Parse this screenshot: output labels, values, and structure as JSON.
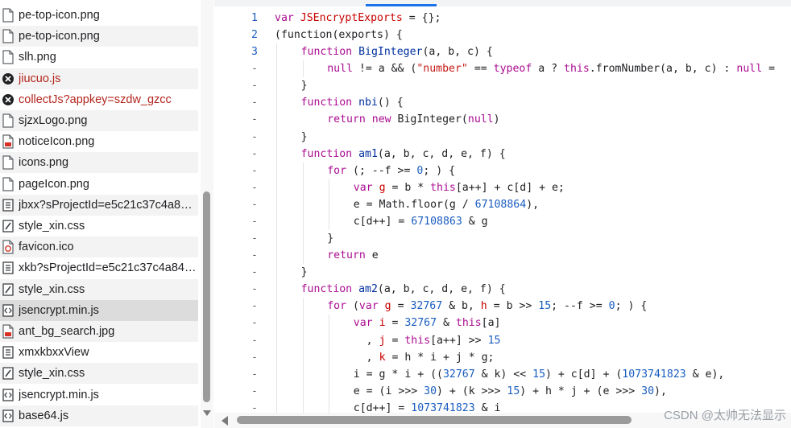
{
  "files": [
    {
      "name": "pe-top-icon.png",
      "icon": "file-icon",
      "error": false
    },
    {
      "name": "pe-top-icon.png",
      "icon": "file-icon",
      "error": false
    },
    {
      "name": "slh.png",
      "icon": "file-icon",
      "error": false
    },
    {
      "name": "jiucuo.js",
      "icon": "error-icon",
      "error": true
    },
    {
      "name": "collectJs?appkey=szdw_gzcc",
      "icon": "error-icon",
      "error": true
    },
    {
      "name": "sjzxLogo.png",
      "icon": "file-icon",
      "error": false
    },
    {
      "name": "noticeIcon.png",
      "icon": "image-file-icon",
      "error": false
    },
    {
      "name": "icons.png",
      "icon": "file-icon",
      "error": false
    },
    {
      "name": "pageIcon.png",
      "icon": "file-icon",
      "error": false
    },
    {
      "name": "jbxx?sProjectId=e5c21c37c4a8…",
      "icon": "document-icon",
      "error": false
    },
    {
      "name": "style_xin.css",
      "icon": "stylesheet-icon",
      "error": false
    },
    {
      "name": "favicon.ico",
      "icon": "favicon-file-icon",
      "error": false
    },
    {
      "name": "xkb?sProjectId=e5c21c37c4a84…",
      "icon": "document-icon",
      "error": false
    },
    {
      "name": "style_xin.css",
      "icon": "stylesheet-icon",
      "error": false
    },
    {
      "name": "jsencrypt.min.js",
      "icon": "script-icon",
      "error": false,
      "selected": true
    },
    {
      "name": "ant_bg_search.jpg",
      "icon": "image-file-icon",
      "error": false
    },
    {
      "name": "xmxkbxxView",
      "icon": "document-icon",
      "error": false
    },
    {
      "name": "style_xin.css",
      "icon": "stylesheet-icon",
      "error": false
    },
    {
      "name": "jsencrypt.min.js",
      "icon": "script-icon",
      "error": false
    },
    {
      "name": "base64.js",
      "icon": "script-icon",
      "error": false
    }
  ],
  "code_lines": [
    {
      "gutter": "1",
      "indent": 0,
      "tokens": [
        [
          "kw",
          "var "
        ],
        [
          "var",
          "JSEncryptExports"
        ],
        [
          "p",
          " = {};"
        ]
      ]
    },
    {
      "gutter": "2",
      "indent": 0,
      "tokens": [
        [
          "p",
          "(function(exports) {"
        ]
      ]
    },
    {
      "gutter": "3",
      "indent": 1,
      "tokens": [
        [
          "kw",
          "function "
        ],
        [
          "fn",
          "BigInteger"
        ],
        [
          "p",
          "(a, b, c) {"
        ]
      ]
    },
    {
      "gutter": "-",
      "indent": 2,
      "tokens": [
        [
          "kw",
          "null"
        ],
        [
          "p",
          " != a && ("
        ],
        [
          "str",
          "\"number\""
        ],
        [
          "p",
          " == "
        ],
        [
          "kw",
          "typeof"
        ],
        [
          "p",
          " a ? "
        ],
        [
          "kw",
          "this"
        ],
        [
          "p",
          ".fromNumber(a, b, c) : "
        ],
        [
          "kw",
          "null"
        ],
        [
          "p",
          " ="
        ]
      ]
    },
    {
      "gutter": "-",
      "indent": 1,
      "tokens": [
        [
          "p",
          "}"
        ]
      ]
    },
    {
      "gutter": "-",
      "indent": 1,
      "tokens": [
        [
          "kw",
          "function "
        ],
        [
          "fn",
          "nbi"
        ],
        [
          "p",
          "() {"
        ]
      ]
    },
    {
      "gutter": "-",
      "indent": 2,
      "tokens": [
        [
          "kw",
          "return new "
        ],
        [
          "p",
          "BigInteger("
        ],
        [
          "kw",
          "null"
        ],
        [
          "p",
          ")"
        ]
      ]
    },
    {
      "gutter": "-",
      "indent": 1,
      "tokens": [
        [
          "p",
          "}"
        ]
      ]
    },
    {
      "gutter": "-",
      "indent": 1,
      "tokens": [
        [
          "kw",
          "function "
        ],
        [
          "fn",
          "am1"
        ],
        [
          "p",
          "(a, b, c, d, e, f) {"
        ]
      ]
    },
    {
      "gutter": "-",
      "indent": 2,
      "tokens": [
        [
          "kw",
          "for"
        ],
        [
          "p",
          " (; --f >= "
        ],
        [
          "num",
          "0"
        ],
        [
          "p",
          "; ) {"
        ]
      ]
    },
    {
      "gutter": "-",
      "indent": 3,
      "tokens": [
        [
          "kw",
          "var "
        ],
        [
          "var",
          "g"
        ],
        [
          "p",
          " = b * "
        ],
        [
          "kw",
          "this"
        ],
        [
          "p",
          "[a++] + c[d] + e;"
        ]
      ]
    },
    {
      "gutter": "-",
      "indent": 3,
      "tokens": [
        [
          "p",
          "e = Math.floor(g / "
        ],
        [
          "num",
          "67108864"
        ],
        [
          "p",
          "),"
        ]
      ]
    },
    {
      "gutter": "-",
      "indent": 3,
      "tokens": [
        [
          "p",
          "c[d++] = "
        ],
        [
          "num",
          "67108863"
        ],
        [
          "p",
          " & g"
        ]
      ]
    },
    {
      "gutter": "-",
      "indent": 2,
      "tokens": [
        [
          "p",
          "}"
        ]
      ]
    },
    {
      "gutter": "-",
      "indent": 2,
      "tokens": [
        [
          "kw",
          "return"
        ],
        [
          "p",
          " e"
        ]
      ]
    },
    {
      "gutter": "-",
      "indent": 1,
      "tokens": [
        [
          "p",
          "}"
        ]
      ]
    },
    {
      "gutter": "-",
      "indent": 1,
      "tokens": [
        [
          "kw",
          "function "
        ],
        [
          "fn",
          "am2"
        ],
        [
          "p",
          "(a, b, c, d, e, f) {"
        ]
      ]
    },
    {
      "gutter": "-",
      "indent": 2,
      "tokens": [
        [
          "kw",
          "for"
        ],
        [
          "p",
          " ("
        ],
        [
          "kw",
          "var "
        ],
        [
          "var",
          "g"
        ],
        [
          "p",
          " = "
        ],
        [
          "num",
          "32767"
        ],
        [
          "p",
          " & b, "
        ],
        [
          "var",
          "h"
        ],
        [
          "p",
          " = b >> "
        ],
        [
          "num",
          "15"
        ],
        [
          "p",
          "; --f >= "
        ],
        [
          "num",
          "0"
        ],
        [
          "p",
          "; ) {"
        ]
      ]
    },
    {
      "gutter": "-",
      "indent": 3,
      "tokens": [
        [
          "kw",
          "var "
        ],
        [
          "var",
          "i"
        ],
        [
          "p",
          " = "
        ],
        [
          "num",
          "32767"
        ],
        [
          "p",
          " & "
        ],
        [
          "kw",
          "this"
        ],
        [
          "p",
          "[a]"
        ]
      ]
    },
    {
      "gutter": "-",
      "indent": 3,
      "tokens": [
        [
          "p",
          "  , "
        ],
        [
          "var",
          "j"
        ],
        [
          "p",
          " = "
        ],
        [
          "kw",
          "this"
        ],
        [
          "p",
          "[a++] >> "
        ],
        [
          "num",
          "15"
        ]
      ]
    },
    {
      "gutter": "-",
      "indent": 3,
      "tokens": [
        [
          "p",
          "  , "
        ],
        [
          "var",
          "k"
        ],
        [
          "p",
          " = h * i + j * g;"
        ]
      ]
    },
    {
      "gutter": "-",
      "indent": 3,
      "tokens": [
        [
          "p",
          "i = g * i + (("
        ],
        [
          "num",
          "32767"
        ],
        [
          "p",
          " & k) << "
        ],
        [
          "num",
          "15"
        ],
        [
          "p",
          ") + c[d] + ("
        ],
        [
          "num",
          "1073741823"
        ],
        [
          "p",
          " & e),"
        ]
      ]
    },
    {
      "gutter": "-",
      "indent": 3,
      "tokens": [
        [
          "p",
          "e = (i >>> "
        ],
        [
          "num",
          "30"
        ],
        [
          "p",
          ") + (k >>> "
        ],
        [
          "num",
          "15"
        ],
        [
          "p",
          ") + h * j + (e >>> "
        ],
        [
          "num",
          "30"
        ],
        [
          "p",
          "),"
        ]
      ]
    },
    {
      "gutter": "-",
      "indent": 3,
      "tokens": [
        [
          "p",
          "c[d++] = "
        ],
        [
          "num",
          "1073741823"
        ],
        [
          "p",
          " & i"
        ]
      ]
    }
  ],
  "watermark": "CSDN @太帅无法显示",
  "colors": {
    "keyword": "#aa0d91",
    "number": "#1a5dbf",
    "string": "#c41a16",
    "error": "#b3261e"
  }
}
